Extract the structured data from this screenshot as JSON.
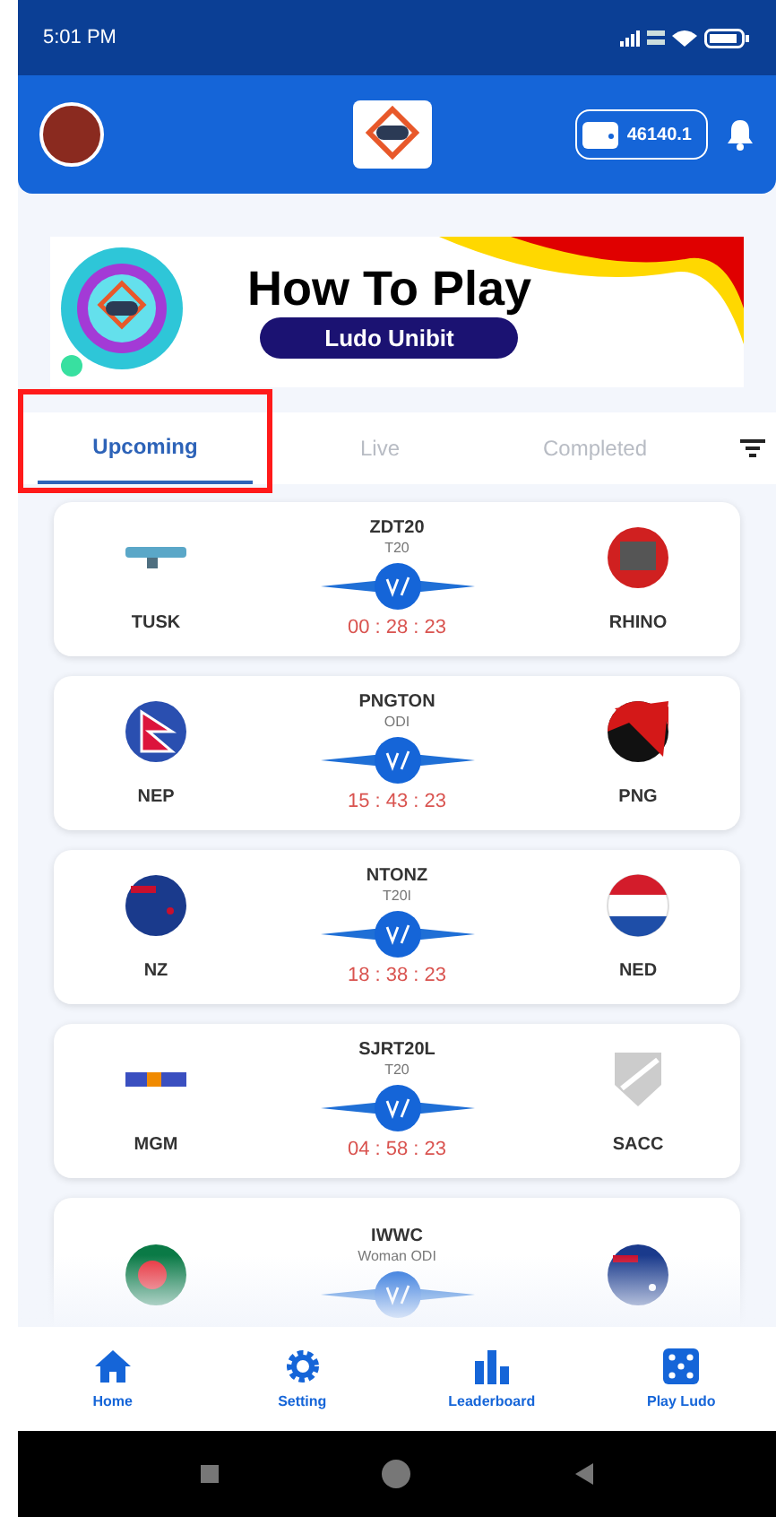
{
  "status_bar": {
    "time": "5:01 PM"
  },
  "header": {
    "balance": "46140.1"
  },
  "banner": {
    "title": "How To Play",
    "subtitle": "Ludo Unibit"
  },
  "tabs": [
    {
      "label": "Upcoming",
      "selected": true,
      "highlighted": true
    },
    {
      "label": "Live",
      "selected": false,
      "highlighted": false
    },
    {
      "label": "Completed",
      "selected": false,
      "highlighted": false
    }
  ],
  "matches": [
    {
      "series": "ZDT20",
      "format": "T20",
      "home": {
        "name": "TUSK",
        "kind": "tusk"
      },
      "away": {
        "name": "RHINO",
        "kind": "rhino"
      },
      "countdown": "00 : 28 : 23"
    },
    {
      "series": "PNGTON",
      "format": "ODI",
      "home": {
        "name": "NEP",
        "kind": "nepal"
      },
      "away": {
        "name": "PNG",
        "kind": "png"
      },
      "countdown": "15 : 43 : 23"
    },
    {
      "series": "NTONZ",
      "format": "T20I",
      "home": {
        "name": "NZ",
        "kind": "nz"
      },
      "away": {
        "name": "NED",
        "kind": "ned"
      },
      "countdown": "18 : 38 : 23"
    },
    {
      "series": "SJRT20L",
      "format": "T20",
      "home": {
        "name": "MGM",
        "kind": "mgm"
      },
      "away": {
        "name": "SACC",
        "kind": "shield"
      },
      "countdown": "04 : 58 : 23"
    },
    {
      "series": "IWWC",
      "format": "Woman ODI",
      "home": {
        "kind": "bangladesh"
      },
      "away": {
        "kind": "australia"
      }
    }
  ],
  "bottom_nav": [
    {
      "label": "Home",
      "kind": "home"
    },
    {
      "label": "Setting",
      "kind": "gear"
    },
    {
      "label": "Leaderboard",
      "kind": "chart"
    },
    {
      "label": "Play Ludo",
      "kind": "dice"
    }
  ]
}
